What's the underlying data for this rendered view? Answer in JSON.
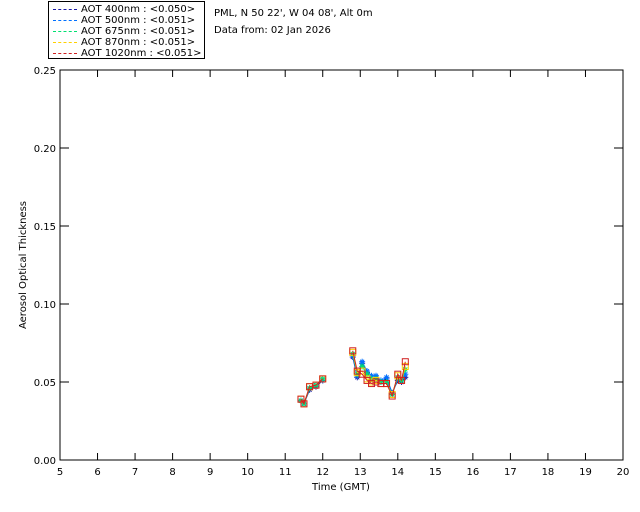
{
  "site": {
    "location": "PML, N 50 22', W 04 08', Alt 0m",
    "data_date": "Data from: 02 Jan 2026"
  },
  "legend": [
    {
      "label": "AOT  400nm : <0.050>",
      "color": "#1a1aa6"
    },
    {
      "label": "AOT  500nm : <0.051>",
      "color": "#0070ff"
    },
    {
      "label": "AOT  675nm : <0.051>",
      "color": "#00e070"
    },
    {
      "label": "AOT  870nm : <0.051>",
      "color": "#ffd000"
    },
    {
      "label": "AOT 1020nm : <0.051>",
      "color": "#d02020"
    }
  ],
  "chart_data": {
    "type": "line",
    "title": "",
    "xlabel": "Time (GMT)",
    "ylabel": "Aerosol Optical Thickness",
    "xlim": [
      5,
      20
    ],
    "ylim": [
      0,
      0.25
    ],
    "x_ticks": [
      5,
      6,
      7,
      8,
      9,
      10,
      11,
      12,
      13,
      14,
      15,
      16,
      17,
      18,
      19,
      20
    ],
    "y_ticks": [
      "0.00",
      "0.05",
      "0.10",
      "0.15",
      "0.20",
      "0.25"
    ],
    "grid": false,
    "segments": [
      [
        11.42,
        11.5,
        11.65,
        11.82,
        12.0
      ],
      [
        12.8,
        12.92,
        13.05,
        13.18,
        13.3,
        13.42,
        13.55,
        13.7,
        13.85,
        14.0,
        14.1,
        14.2
      ]
    ],
    "series": [
      {
        "name": "AOT  400nm",
        "color": "#1a1aa6",
        "segments": [
          [
            0.038,
            0.036,
            0.045,
            0.047,
            0.051
          ],
          [
            0.066,
            0.053,
            0.062,
            0.056,
            0.052,
            0.053,
            0.05,
            0.052,
            0.043,
            0.051,
            0.05,
            0.053
          ]
        ]
      },
      {
        "name": "AOT  500nm",
        "color": "#0070ff",
        "segments": [
          [
            0.038,
            0.036,
            0.046,
            0.048,
            0.051
          ],
          [
            0.067,
            0.054,
            0.063,
            0.057,
            0.054,
            0.054,
            0.051,
            0.053,
            0.043,
            0.052,
            0.051,
            0.055
          ]
        ]
      },
      {
        "name": "AOT  675nm",
        "color": "#00e070",
        "segments": [
          [
            0.038,
            0.036,
            0.046,
            0.048,
            0.052
          ],
          [
            0.068,
            0.055,
            0.06,
            0.055,
            0.052,
            0.052,
            0.05,
            0.05,
            0.042,
            0.053,
            0.051,
            0.058
          ]
        ]
      },
      {
        "name": "AOT  870nm",
        "color": "#ffd000",
        "segments": [
          [
            0.039,
            0.036,
            0.047,
            0.048,
            0.052
          ],
          [
            0.069,
            0.056,
            0.057,
            0.052,
            0.05,
            0.051,
            0.049,
            0.049,
            0.042,
            0.054,
            0.051,
            0.06
          ]
        ]
      },
      {
        "name": "AOT 1020nm",
        "color": "#d02020",
        "segments": [
          [
            0.039,
            0.036,
            0.047,
            0.048,
            0.052
          ],
          [
            0.07,
            0.057,
            0.055,
            0.051,
            0.049,
            0.05,
            0.049,
            0.049,
            0.041,
            0.055,
            0.051,
            0.063
          ]
        ]
      }
    ]
  }
}
